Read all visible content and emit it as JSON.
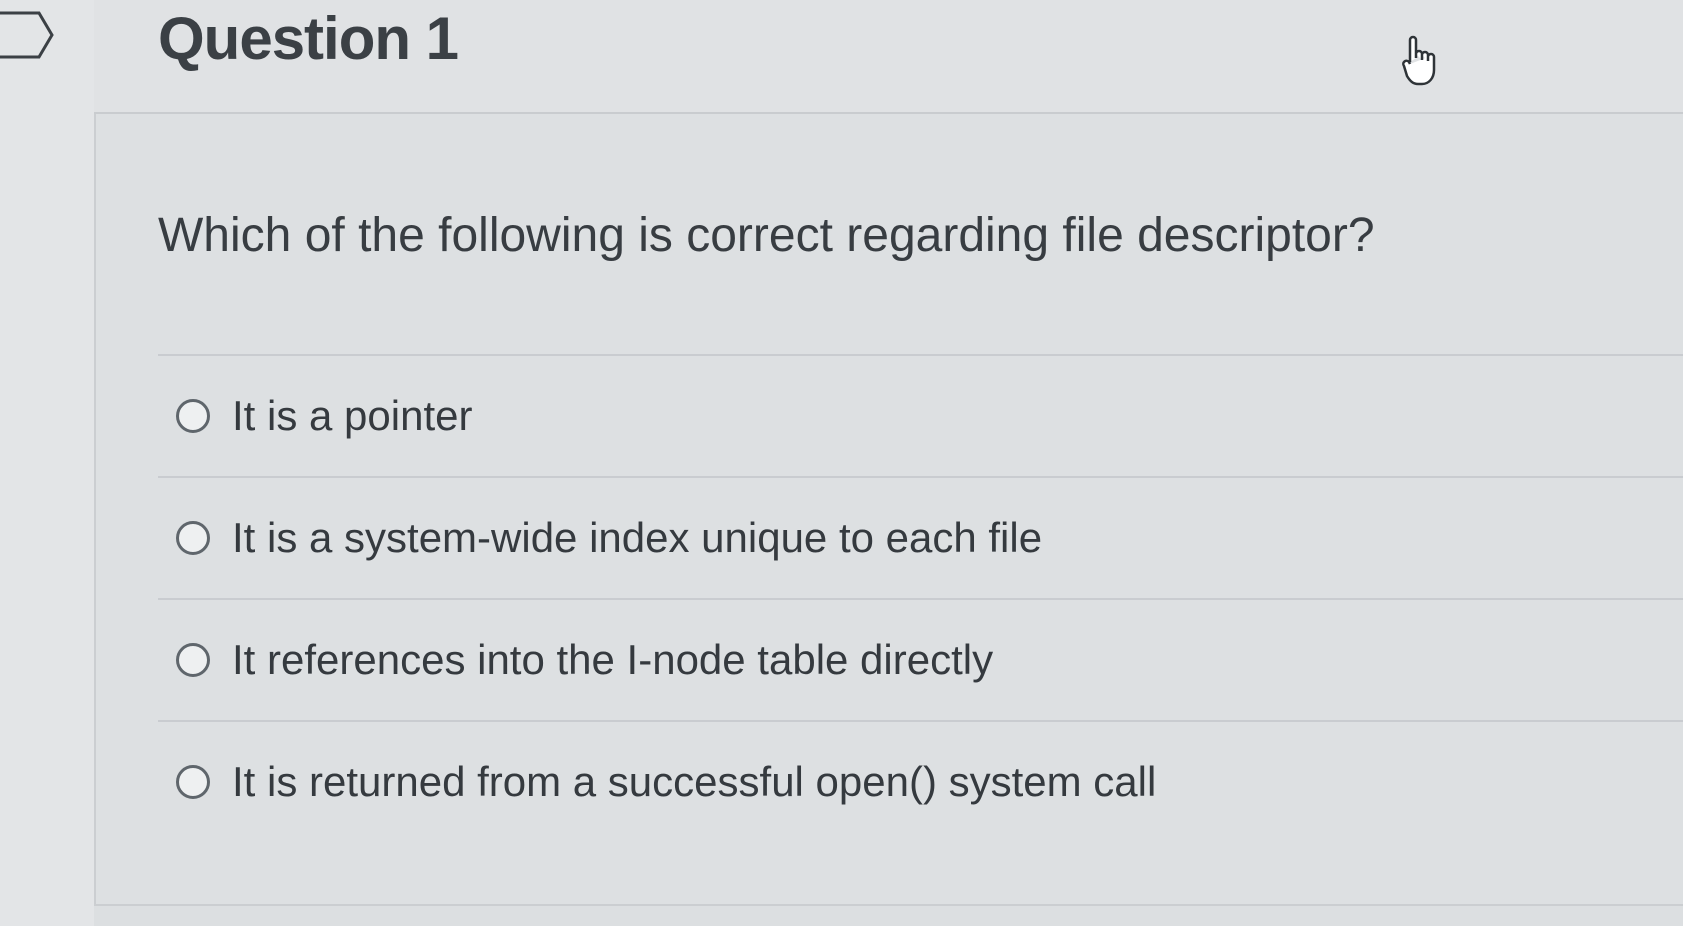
{
  "question": {
    "title": "Question 1",
    "prompt": "Which of the following is correct regarding file descriptor?",
    "options": [
      {
        "label": "It is a pointer",
        "selected": false
      },
      {
        "label": "It is a system-wide index unique to each file",
        "selected": false
      },
      {
        "label": "It references into the I-node table directly",
        "selected": false
      },
      {
        "label": "It is returned from a successful open() system call",
        "selected": false
      }
    ]
  },
  "icons": {
    "flag": "flag-icon",
    "cursor": "hand-pointer-icon"
  }
}
